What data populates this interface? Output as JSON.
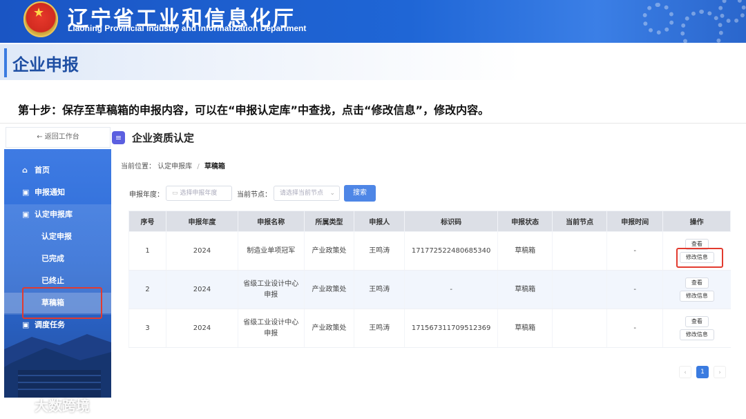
{
  "banner": {
    "title": "辽宁省工业和信息化厅",
    "subtitle": "Liaoning Provincial Industry and Informatization Department"
  },
  "section": {
    "title": "企业申报"
  },
  "instruction": "第十步：保存至草稿箱的申报内容，可以在“申报认定库”中查找，点击“修改信息”，修改内容。",
  "sidebar": {
    "back_label": "← 返回工作台",
    "items": [
      {
        "label": "首页",
        "icon": "home-icon"
      },
      {
        "label": "申报通知",
        "icon": "lock-icon"
      },
      {
        "label": "认定申报库",
        "icon": "lock-icon"
      },
      {
        "label": "认定申报"
      },
      {
        "label": "已完成"
      },
      {
        "label": "已终止"
      },
      {
        "label": "草稿箱"
      },
      {
        "label": "调度任务",
        "icon": "lock-icon"
      }
    ]
  },
  "main": {
    "title": "企业资质认定",
    "breadcrumb": {
      "prefix": "当前位置：",
      "parent": "认定申报库",
      "sep": "/",
      "current": "草稿箱"
    },
    "filters": {
      "year_label": "申报年度：",
      "year_placeholder": "选择申报年度",
      "node_label": "当前节点：",
      "node_placeholder": "请选择当前节点",
      "search_label": "搜索"
    },
    "table": {
      "headers": [
        "序号",
        "申报年度",
        "申报名称",
        "所属类型",
        "申报人",
        "标识码",
        "申报状态",
        "当前节点",
        "申报时间",
        "操作"
      ],
      "rows": [
        {
          "no": "1",
          "year": "2024",
          "name": "制造业单项冠军",
          "type": "产业政策处",
          "applicant": "王鸣涛",
          "code": "171772522480685340",
          "status": "草稿箱",
          "node": "",
          "time": "-"
        },
        {
          "no": "2",
          "year": "2024",
          "name": "省级工业设计中心申报",
          "type": "产业政策处",
          "applicant": "王鸣涛",
          "code": "-",
          "status": "草稿箱",
          "node": "",
          "time": "-"
        },
        {
          "no": "3",
          "year": "2024",
          "name": "省级工业设计中心申报",
          "type": "产业政策处",
          "applicant": "王鸣涛",
          "code": "171567311709512369",
          "status": "草稿箱",
          "node": "",
          "time": "-"
        }
      ],
      "view_label": "查看",
      "edit_label": "修改信息"
    },
    "pagination": {
      "prev": "‹",
      "current": "1",
      "next": "›"
    }
  },
  "watermark": "大数跨境",
  "colors": {
    "brand": "#1f66d6",
    "highlight": "#e23a2e",
    "search": "#4e86e6"
  }
}
